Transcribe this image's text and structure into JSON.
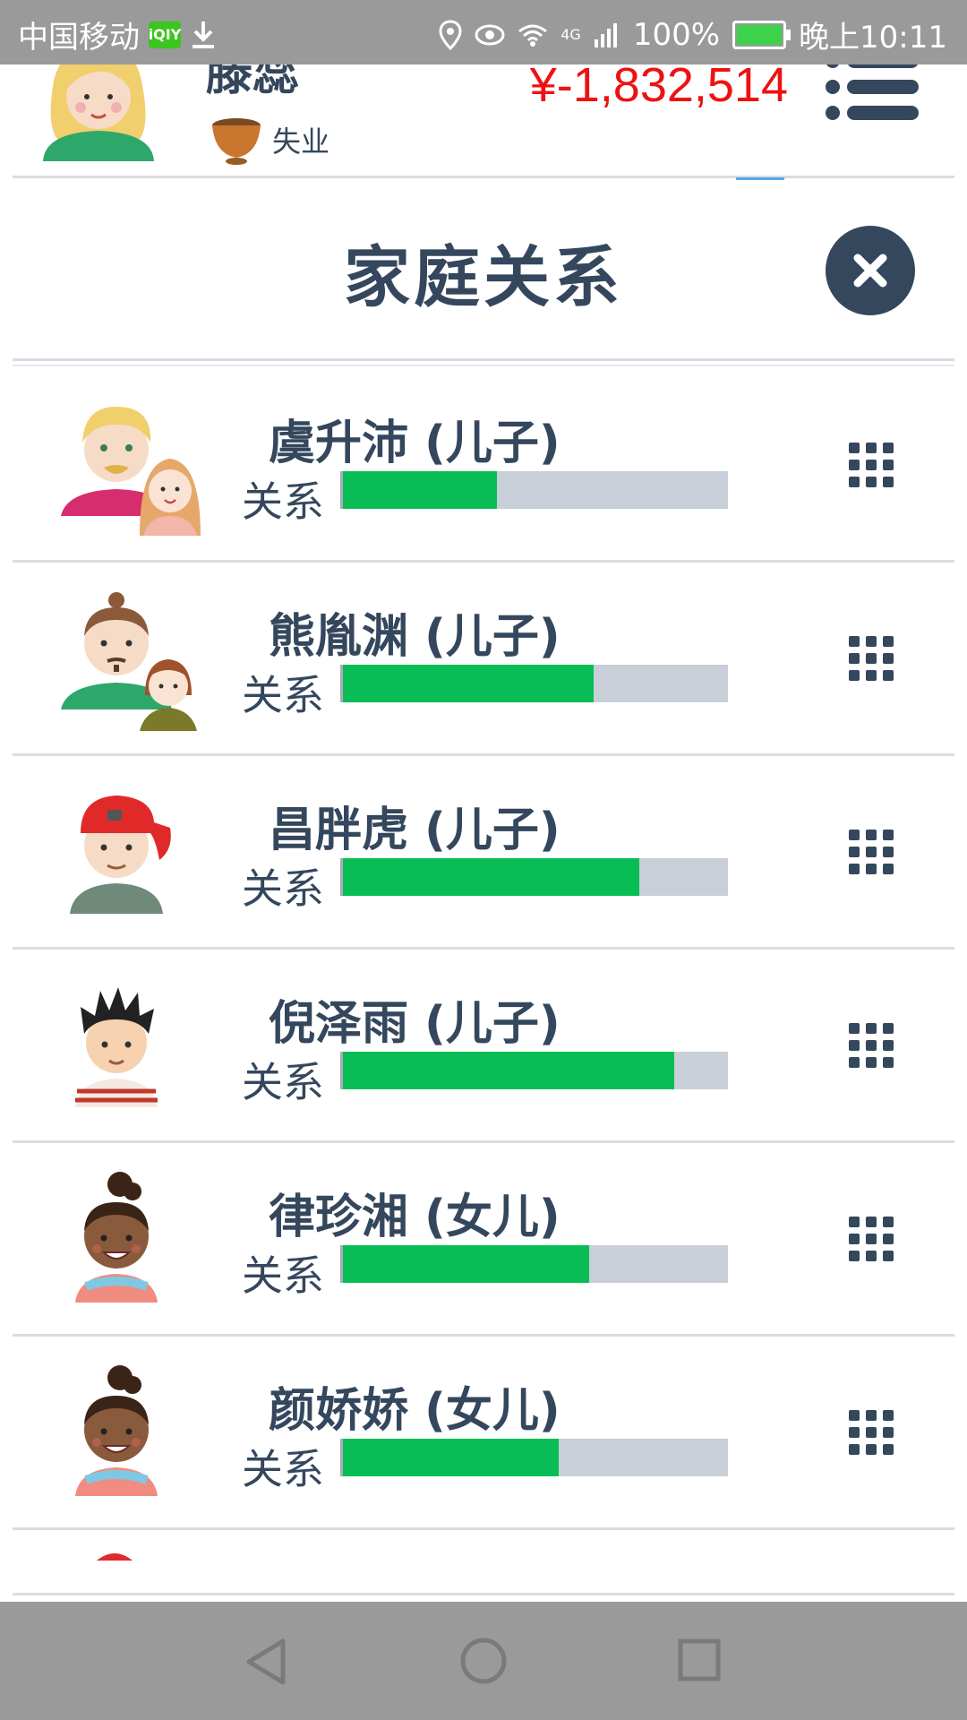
{
  "status_bar": {
    "carrier": "中国移动",
    "app_icon": "iqiyi",
    "battery": "100%",
    "time": "晚上10:11",
    "network": "4G"
  },
  "header": {
    "username": "滕蕊",
    "job": "失业",
    "money": "¥-1,832,514"
  },
  "dialog": {
    "title": "家庭关系"
  },
  "relation_label": "关系",
  "members": [
    {
      "name": "虞升沛 (儿子)",
      "relation": 0.4,
      "avatar": "blonde-man-with-girl"
    },
    {
      "name": "熊胤渊 (儿子)",
      "relation": 0.65,
      "avatar": "bun-man-with-girl"
    },
    {
      "name": "昌胖虎 (儿子)",
      "relation": 0.77,
      "avatar": "red-cap-boy"
    },
    {
      "name": "倪泽雨 (儿子)",
      "relation": 0.86,
      "avatar": "spiky-hair-boy"
    },
    {
      "name": "律珍湘 (女儿)",
      "relation": 0.64,
      "avatar": "curly-bun-girl"
    },
    {
      "name": "颜娇娇 (女儿)",
      "relation": 0.56,
      "avatar": "curly-bun-girl"
    }
  ],
  "colors": {
    "primary": "#34475d",
    "money": "#ee1111",
    "bar_fill": "#08bd55",
    "bar_track": "#c8cfd8"
  }
}
